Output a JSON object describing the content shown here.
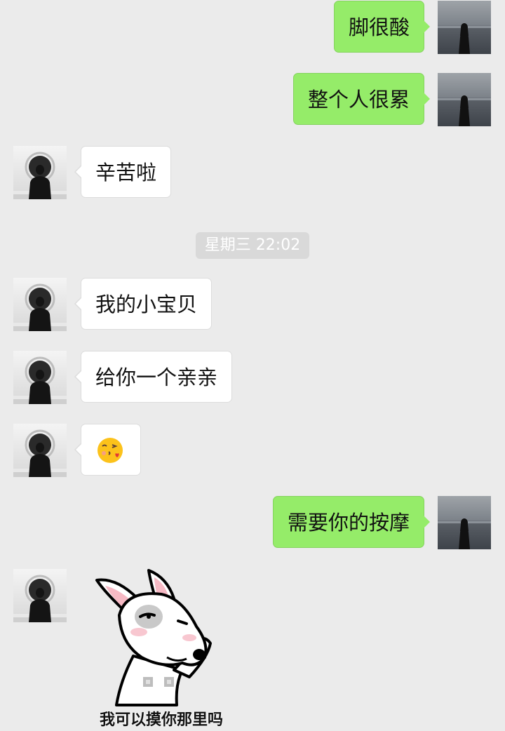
{
  "conversation": {
    "messages": [
      {
        "from": "me",
        "text": "脚很酸"
      },
      {
        "from": "me",
        "text": "整个人很累"
      },
      {
        "from": "other",
        "text": "辛苦啦"
      },
      {
        "from": "other",
        "text": "我的小宝贝"
      },
      {
        "from": "other",
        "text": "给你一个亲亲"
      },
      {
        "from": "other",
        "emoji": "😘"
      },
      {
        "from": "me",
        "text": "需要你的按摩"
      }
    ],
    "timestamp": "星期三 22:02",
    "sticker": {
      "caption": "我可以摸你那里吗",
      "icon": "bull-terrier-dog-sticker"
    }
  },
  "colors": {
    "background": "#ebebeb",
    "outgoing_bubble": "#95ec69",
    "incoming_bubble": "#ffffff",
    "timestamp_bg": "#d9d9d9"
  },
  "avatars": {
    "me": "woman-by-sea-avatar",
    "other": "man-silhouette-avatar"
  }
}
